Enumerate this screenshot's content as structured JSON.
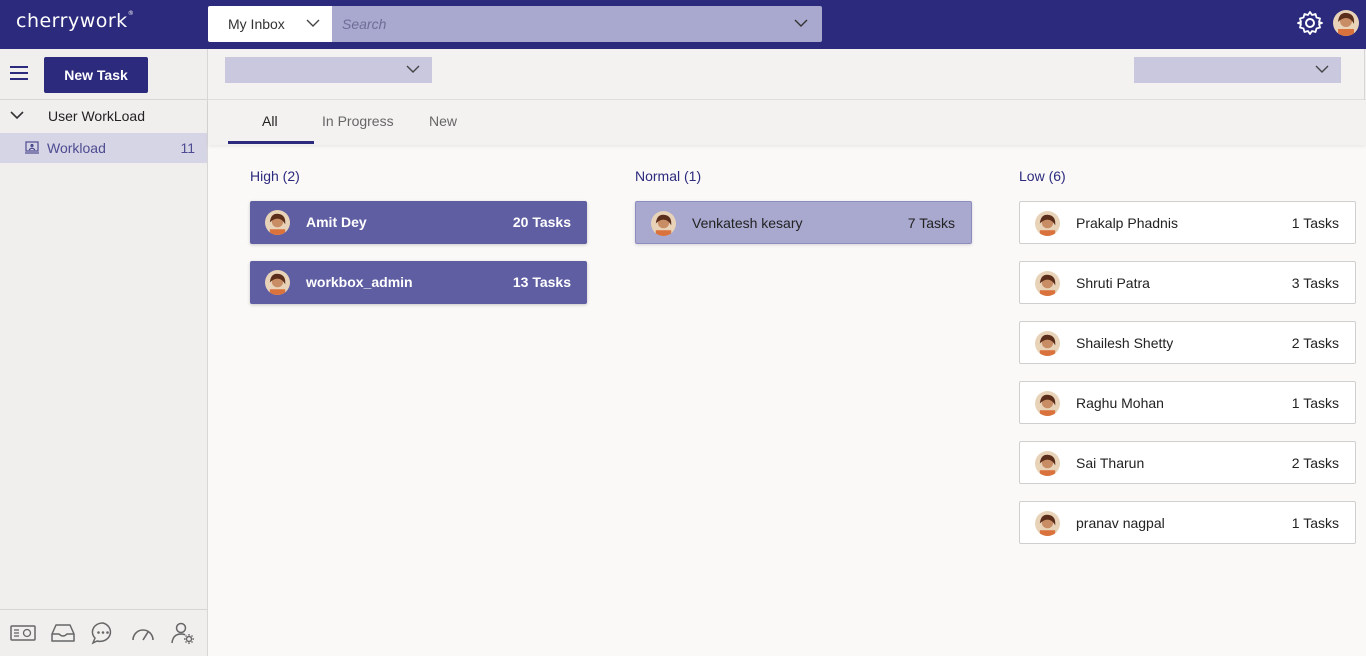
{
  "app": {
    "logo": "cherrywork",
    "trademark": "®"
  },
  "header": {
    "inbox_select": "My Inbox",
    "search_placeholder": "Search"
  },
  "sidebar": {
    "new_task_label": "New Task",
    "group_label": "User WorkLoad",
    "item_label": "Workload",
    "item_count": "11",
    "bottom_icons": [
      "id-card-icon",
      "inbox-icon",
      "chat-icon",
      "speedometer-icon",
      "user-settings-icon"
    ]
  },
  "tabs": [
    {
      "label": "All",
      "active": true
    },
    {
      "label": "In Progress",
      "active": false
    },
    {
      "label": "New",
      "active": false
    }
  ],
  "columns": [
    {
      "title": "High (2)",
      "style": "high",
      "cards": [
        {
          "name": "Amit Dey",
          "tasks": "20 Tasks"
        },
        {
          "name": "workbox_admin",
          "tasks": "13 Tasks"
        }
      ]
    },
    {
      "title": "Normal (1)",
      "style": "normal",
      "cards": [
        {
          "name": "Venkatesh kesary",
          "tasks": "7 Tasks"
        }
      ]
    },
    {
      "title": "Low (6)",
      "style": "low",
      "cards": [
        {
          "name": "Prakalp Phadnis",
          "tasks": "1 Tasks"
        },
        {
          "name": "Shruti Patra",
          "tasks": "3 Tasks"
        },
        {
          "name": "Shailesh Shetty",
          "tasks": "2 Tasks"
        },
        {
          "name": "Raghu Mohan",
          "tasks": "1 Tasks"
        },
        {
          "name": "Sai Tharun",
          "tasks": "2 Tasks"
        },
        {
          "name": "pranav nagpal",
          "tasks": "1 Tasks"
        }
      ]
    }
  ],
  "colors": {
    "brand": "#2c2a7c",
    "high": "#605ea3",
    "normal": "#a9a8cf",
    "low": "#ffffff"
  }
}
